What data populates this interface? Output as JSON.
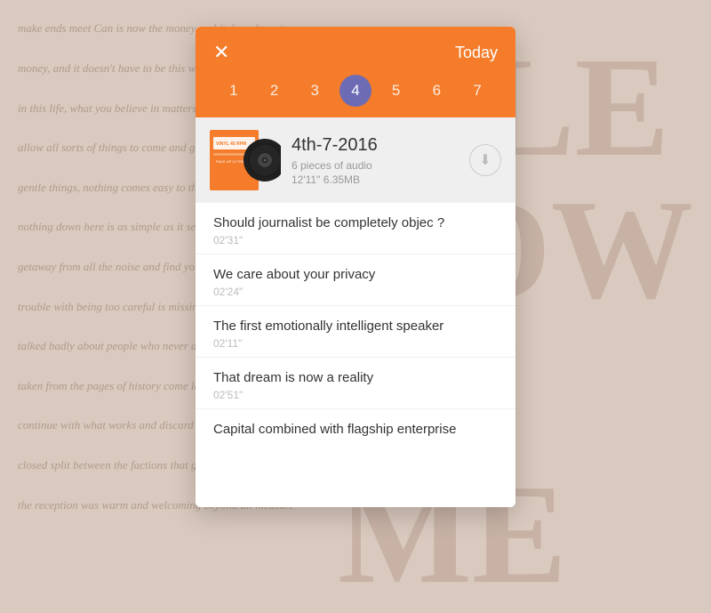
{
  "background": {
    "lines": [
      "make ends meet  Can is now t",
      "money, and it doesn't",
      "in this life, w",
      "allow all sorts",
      "gentle things, n",
      "nothing dow",
      "getaway from",
      "rouble with b",
      "talked badly",
      "taken from the",
      "continue with",
      "closed split",
      "the reception"
    ],
    "bigText": "A'LE NOW SU ME"
  },
  "header": {
    "close_label": "✕",
    "today_label": "Today"
  },
  "days": [
    {
      "number": "1",
      "active": false
    },
    {
      "number": "2",
      "active": false
    },
    {
      "number": "3",
      "active": false
    },
    {
      "number": "4",
      "active": true
    },
    {
      "number": "5",
      "active": false
    },
    {
      "number": "6",
      "active": false
    },
    {
      "number": "7",
      "active": false
    }
  ],
  "album": {
    "date": "4th-7-2016",
    "pieces": "6 pieces of audio",
    "duration": "12'11\"  6.35MB"
  },
  "tracks": [
    {
      "title": "Should journalist be completely objec ?",
      "duration": "02'31\""
    },
    {
      "title": "We care about your privacy",
      "duration": "02'24\""
    },
    {
      "title": "The first emotionally intelligent speaker",
      "duration": "02'11\""
    },
    {
      "title": "That dream is now a reality",
      "duration": "02'51\""
    },
    {
      "title": "Capital combined with  flagship enterprise",
      "duration": ""
    }
  ],
  "colors": {
    "orange": "#f47c2a",
    "purple": "#6e6bb5",
    "bg": "#d9c9be"
  }
}
